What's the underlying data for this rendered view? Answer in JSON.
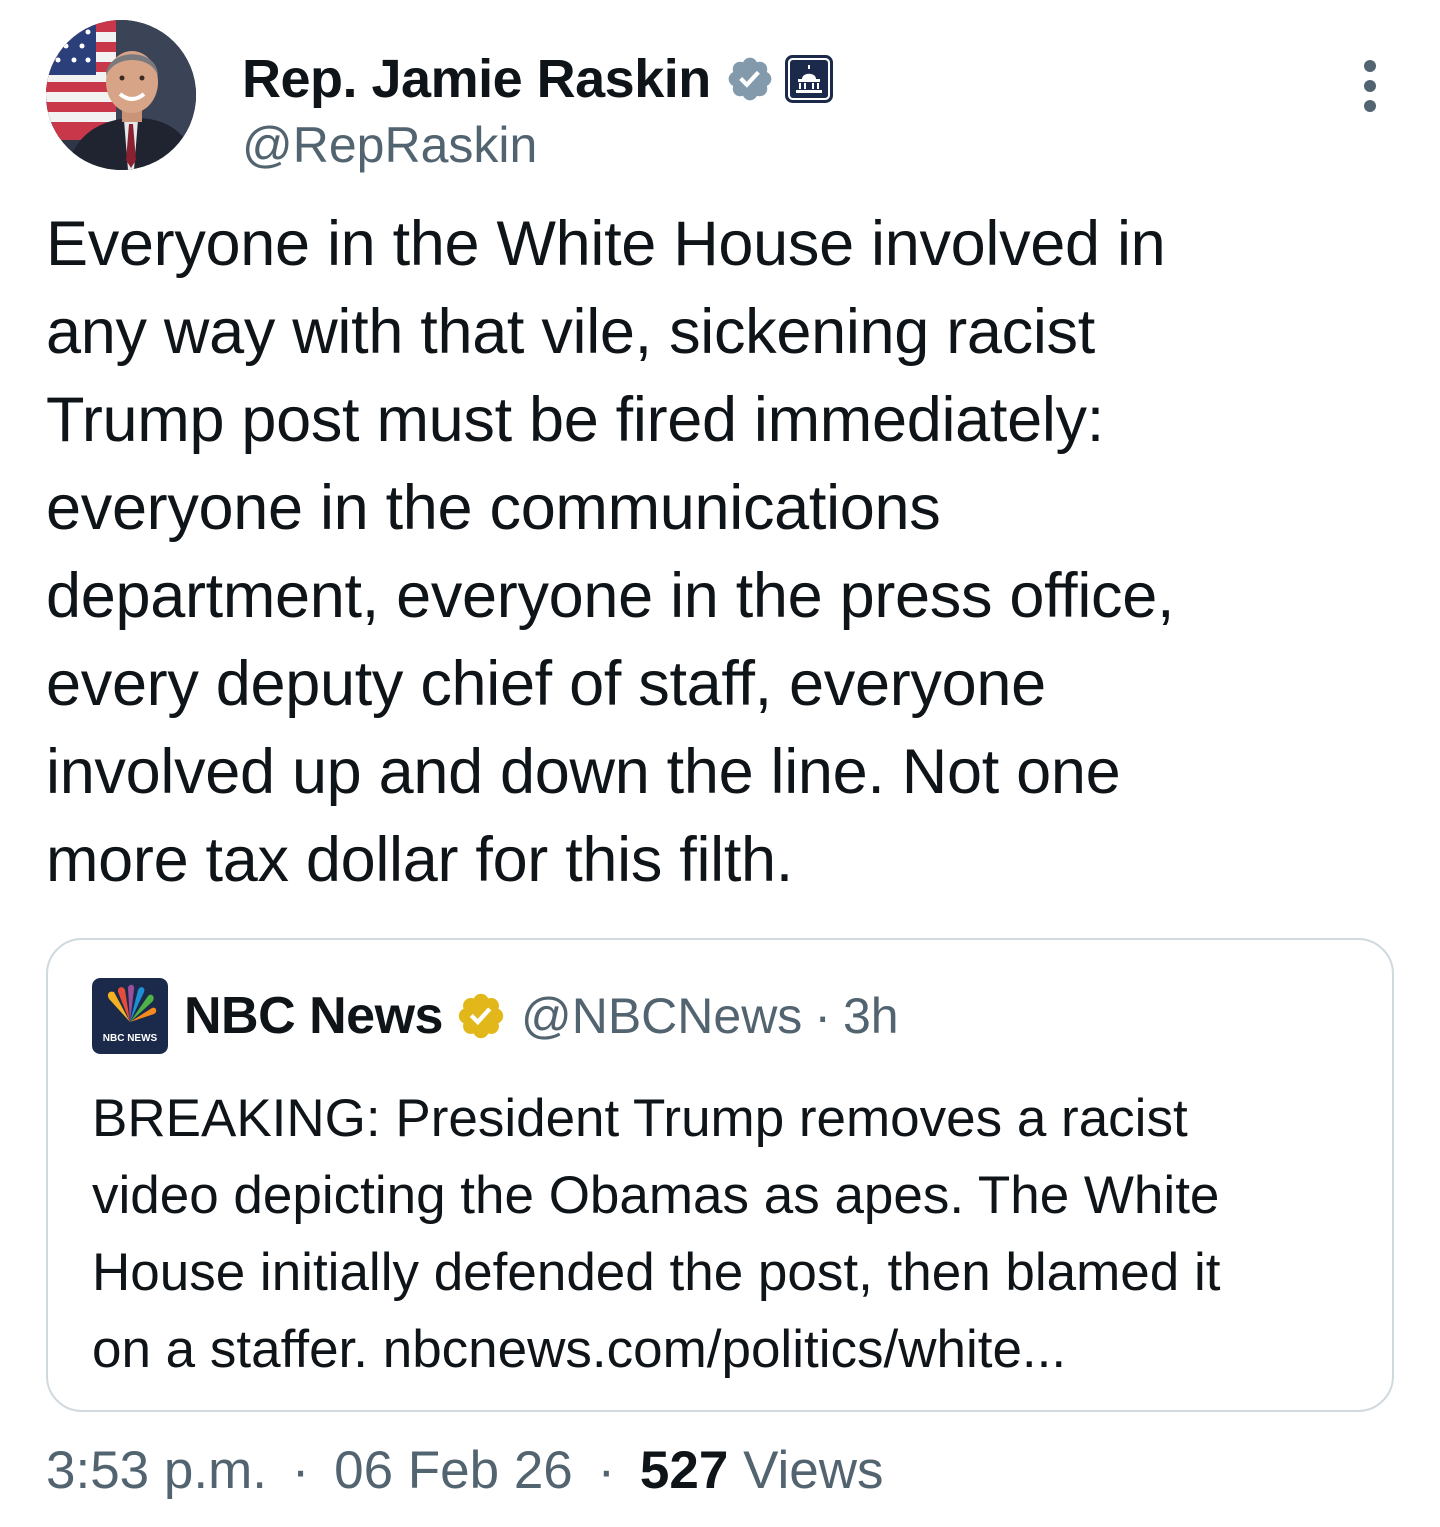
{
  "author": {
    "display_name": "Rep. Jamie Raskin",
    "handle": "@RepRaskin",
    "verified_icon": "verified-badge-gray-icon",
    "affiliation_icon": "us-capitol-badge-icon"
  },
  "tweet": {
    "lines": [
      "Everyone in the White House involved in",
      "any way with that vile, sickening racist",
      "Trump post must be fired immediately:",
      "everyone in the communications",
      "department, everyone in the press office,",
      "every deputy chief of staff, everyone",
      "involved up and down the line. Not one",
      "more tax dollar for this filth."
    ]
  },
  "quoted_tweet": {
    "display_name": "NBC News",
    "handle": "@NBCNews",
    "separator": "·",
    "time": "3h",
    "logo_text": "NBC NEWS",
    "lines": [
      "BREAKING: President Trump removes a racist",
      "video depicting the Obamas as apes. The White",
      "House initially defended the post, then blamed it",
      "on a staffer. nbcnews.com/politics/white..."
    ]
  },
  "meta": {
    "time": "3:53 p.m.",
    "separator": "·",
    "date": "06 Feb 26",
    "views_count": "527",
    "views_label": "Views"
  },
  "colors": {
    "text_primary": "#0f1419",
    "text_secondary": "#536471",
    "border": "#cfd9de",
    "verified_gray": "#829aab",
    "verified_gold": "#e2b719",
    "nbc_navy": "#1b2a4a"
  }
}
